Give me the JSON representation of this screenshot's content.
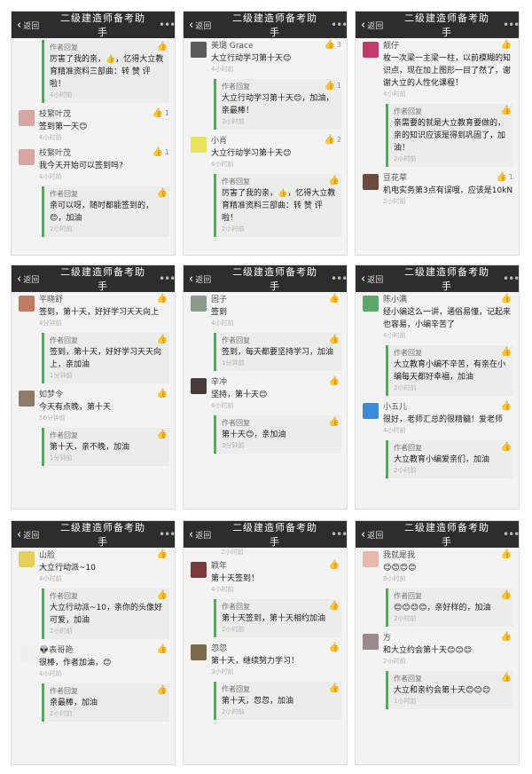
{
  "header": {
    "back_label": "返回",
    "title": "二级建造师备考助手",
    "more": "•••"
  },
  "panels": [
    {
      "entries": [
        {
          "type": "reply",
          "label": "作者回复",
          "text": "厉害了我的亲，👍，忆得大立教育精准资料三部曲：转 赞 评啦！",
          "time": "4小时前",
          "likes": ""
        },
        {
          "type": "comment",
          "avatar": "#d8a6a0",
          "name": "枝繁叶茂",
          "text": "签到第一天😊",
          "time": "4小时前",
          "likes": "1"
        },
        {
          "type": "comment",
          "avatar": "#d8a6a0",
          "name": "枝繁叶茂",
          "text": "我今天开始可以签到吗?",
          "time": "4小时前",
          "likes": "1"
        },
        {
          "type": "reply",
          "label": "作者回复",
          "text": "亲可以呀，随时都能签到的，😊，加油",
          "time": "2小时前",
          "likes": ""
        }
      ]
    },
    {
      "entries": [
        {
          "type": "comment",
          "avatar": "#5a5a5a",
          "name": "美璐 Grace",
          "text": "大立行动学习第十天😊",
          "time": "4小时前",
          "likes": "3"
        },
        {
          "type": "reply",
          "label": "作者回复",
          "text": "大立行动学习第十天😊，加油，亲最棒！",
          "time": "3小时前",
          "likes": "1"
        },
        {
          "type": "comment",
          "avatar": "#e8e35a",
          "name": "小肖",
          "text": "大立行动学习第十天😊",
          "time": "4小时前",
          "likes": "2"
        },
        {
          "type": "reply",
          "label": "作者回复",
          "text": "厉害了我的亲，👍，忆得大立教育精准资料三部曲：转 赞 评啦！",
          "time": "2小时前",
          "likes": ""
        }
      ]
    },
    {
      "entries": [
        {
          "type": "comment",
          "avatar": "#c23a6a",
          "name": "靓仔",
          "text": "枚一次梁一主梁一柱，以前模糊的知识点，现在加上图形一目了然了，谢谢大立的人性化课程！",
          "time": "4小时前",
          "likes": ""
        },
        {
          "type": "reply",
          "label": "作者回复",
          "text": "亲需要的就是大立教育要做的，亲的知识应该是得到巩固了，加油！",
          "time": "2小时前",
          "likes": ""
        },
        {
          "type": "comment",
          "avatar": "#6b4b3a",
          "name": "豆花草",
          "text": "机电实务第3点有误哦，应该是10kN",
          "time": "2小时前",
          "likes": "1"
        }
      ]
    },
    {
      "entries": [
        {
          "type": "comment",
          "avatar": "#c07a63",
          "name": "平晓舒",
          "text": "签到，第十天，好好学习天天向上",
          "time": "4分钟前",
          "likes": ""
        },
        {
          "type": "reply",
          "label": "作者回复",
          "text": "签到，第十天，好好学习天天向上，亲加油",
          "time": "1分钟前",
          "likes": ""
        },
        {
          "type": "comment",
          "avatar": "#8d7a6a",
          "name": "如梦令",
          "text": "今天有点晚，第十天",
          "time": "56分钟前",
          "likes": ""
        },
        {
          "type": "reply",
          "label": "作者回复",
          "text": "第十天，亲不晚，加油",
          "time": "1分钟前",
          "likes": ""
        }
      ]
    },
    {
      "top_time": "",
      "entries": [
        {
          "type": "comment",
          "avatar": "#8a9b8a",
          "name": "固子",
          "text": "签到",
          "time": "4小时前",
          "likes": ""
        },
        {
          "type": "reply",
          "label": "作者回复",
          "text": "签到，每天都要坚持学习，加油",
          "time": "1分钟前",
          "likes": ""
        },
        {
          "type": "comment",
          "avatar": "#4a3a3a",
          "name": "辛冲",
          "text": "坚持，第十天😊",
          "time": "4小时前",
          "likes": ""
        },
        {
          "type": "reply",
          "label": "作者回复",
          "text": "第十天😊，亲加油",
          "time": "3分钟前",
          "likes": ""
        }
      ]
    },
    {
      "entries": [
        {
          "type": "comment",
          "avatar": "#5aa86a",
          "name": "陈小满",
          "text": "经小编这么一讲，通俗易懂，记起来也容易，小编辛苦了",
          "time": "4小时前",
          "likes": ""
        },
        {
          "type": "reply",
          "label": "作者回复",
          "text": "大立教育小编不辛苦，有亲在小编每天都好幸福，加油",
          "time": "2小时前",
          "likes": ""
        },
        {
          "type": "comment",
          "avatar": "#3a8ad8",
          "name": "小五儿",
          "text": "很好，老师汇总的很精髓！爱老师",
          "time": "4小时前",
          "likes": ""
        },
        {
          "type": "reply",
          "label": "作者回复",
          "text": "大立教育小编爱亲们，加油",
          "time": "2小时前",
          "likes": ""
        }
      ]
    },
    {
      "entries": [
        {
          "type": "comment",
          "avatar": "#e8cf5a",
          "name": "山脸",
          "text": "大立行动派~10",
          "time": "4小时前",
          "likes": ""
        },
        {
          "type": "reply",
          "label": "作者回复",
          "text": "大立行动派~10，亲你的头像好可爱，加油",
          "time": "2小时前",
          "likes": ""
        },
        {
          "type": "comment",
          "avatar": "#f0f0f0",
          "name": "👽表哥艳",
          "text": "很棒，作者加油，😊",
          "time": "4小时前",
          "likes": ""
        },
        {
          "type": "reply",
          "label": "作者回复",
          "text": "亲最棒，加油",
          "time": "2小时前",
          "likes": ""
        }
      ]
    },
    {
      "top_time": "2小时前",
      "entries": [
        {
          "type": "comment",
          "avatar": "#7a3a3a",
          "name": "颖年",
          "text": "第十天签到！",
          "time": "4小时前",
          "likes": ""
        },
        {
          "type": "reply",
          "label": "作者回复",
          "text": "第十天签到，第十天相约加油",
          "time": "2小时前",
          "likes": ""
        },
        {
          "type": "comment",
          "avatar": "#7a6a4a",
          "name": "忽忽",
          "text": "第十天，继续努力学习！",
          "time": "3小时前",
          "likes": ""
        },
        {
          "type": "reply",
          "label": "作者回复",
          "text": "第十天，忽忽，加油",
          "time": "2小时前",
          "likes": ""
        }
      ]
    },
    {
      "entries": [
        {
          "type": "comment",
          "avatar": "#e8b8a8",
          "name": "我就是我",
          "text": "😊😊😊😊",
          "time": "3小时前",
          "likes": ""
        },
        {
          "type": "reply",
          "label": "作者回复",
          "text": "😊😊😊😊，亲好样的，加油",
          "time": "2小时前",
          "likes": ""
        },
        {
          "type": "comment",
          "avatar": "#9a8a8a",
          "name": "方",
          "text": "和大立约会第十天😊😊😊",
          "time": "2小时前",
          "likes": ""
        },
        {
          "type": "reply",
          "label": "作者回复",
          "text": "大立和亲约会第十天😊😊😊",
          "time": "1小时前",
          "likes": ""
        }
      ]
    }
  ]
}
